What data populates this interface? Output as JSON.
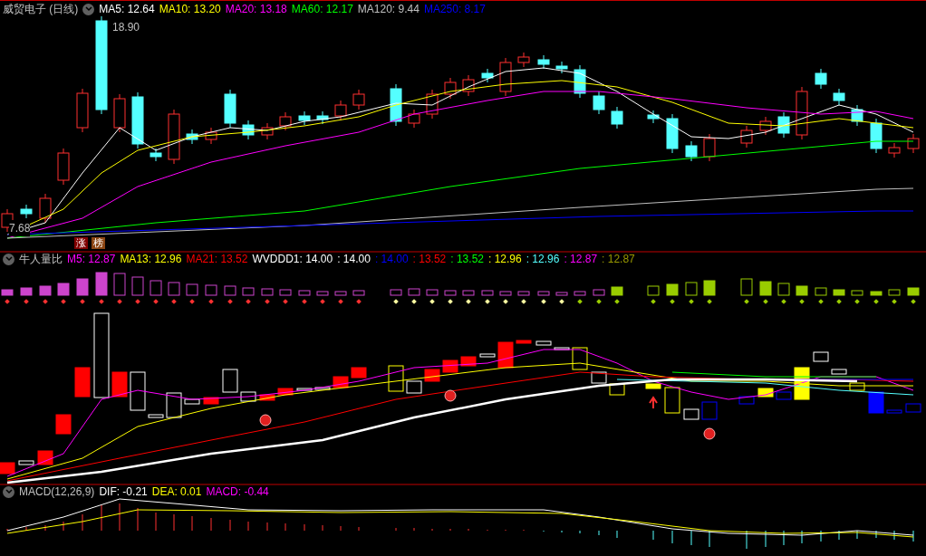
{
  "price_pane": {
    "title": "威贸电子 (日线)",
    "indicators": [
      {
        "label": "MA5: 12.64",
        "color": "#ffffff"
      },
      {
        "label": "MA10: 13.20",
        "color": "#ffff00"
      },
      {
        "label": "MA20: 13.18",
        "color": "#ff00ff"
      },
      {
        "label": "MA60: 12.17",
        "color": "#00ff00"
      },
      {
        "label": "MA120: 9.44",
        "color": "#c0c0c0"
      },
      {
        "label": "MA250: 8.17",
        "color": "#0000ff"
      }
    ],
    "high_label": "18.90",
    "low_label": "7.68",
    "badges": [
      {
        "text": "涨",
        "color": "#800000"
      },
      {
        "text": "榜",
        "color": "#8b4513"
      }
    ]
  },
  "volume_pane": {
    "title": "牛人量比",
    "indicators": [
      {
        "label": "M5: 12.87",
        "color": "#ff00ff"
      },
      {
        "label": "MA13: 12.96",
        "color": "#ffff00"
      },
      {
        "label": "MA21: 13.52",
        "color": "#ff0000"
      },
      {
        "label": "WVDDD1: 14.00",
        "color": "#ffffff"
      },
      {
        "label": ": 14.00",
        "color": "#ffffff"
      },
      {
        "label": ": 14.00",
        "color": "#0000ff"
      },
      {
        "label": ": 13.52",
        "color": "#ff0000"
      },
      {
        "label": ": 13.52",
        "color": "#00ff00"
      },
      {
        "label": ": 12.96",
        "color": "#ffff00"
      },
      {
        "label": ": 12.96",
        "color": "#54ffff"
      },
      {
        "label": ": 12.87",
        "color": "#ff00ff"
      },
      {
        "label": ": 12.87",
        "color": "#999900"
      }
    ]
  },
  "macd_pane": {
    "title": "MACD(12,26,9)",
    "indicators": [
      {
        "label": "DIF: -0.21",
        "color": "#ffffff"
      },
      {
        "label": "DEA: 0.01",
        "color": "#ffff00"
      },
      {
        "label": "MACD: -0.44",
        "color": "#ff00ff"
      }
    ]
  }
}
